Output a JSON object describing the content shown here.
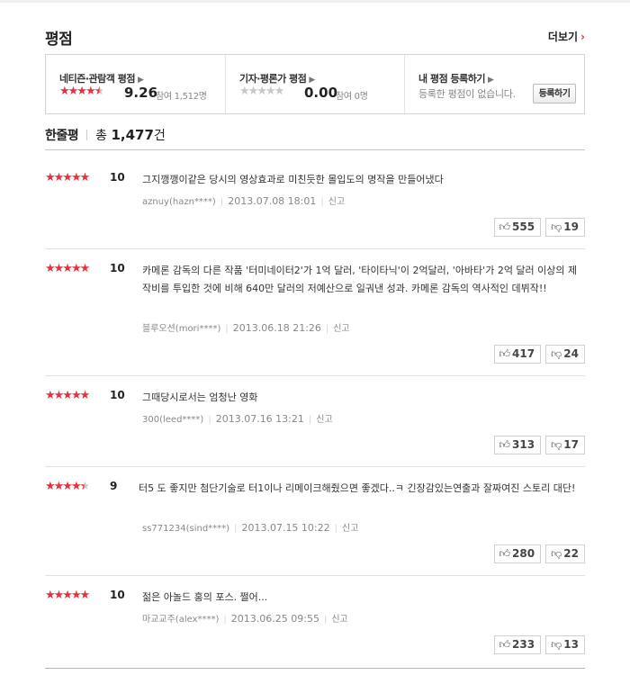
{
  "section": {
    "title": "평점",
    "more_label": "더보기",
    "more_chevron": "›"
  },
  "summary": {
    "netizen": {
      "label": "네티즌·관람객 평점",
      "stars": "★★★★★",
      "score": "9.26",
      "count": "참여 1,512명",
      "rating_fraction": 0.926
    },
    "critic": {
      "label": "기자·평론가 평점",
      "stars": "★★★★★",
      "score": "0.00",
      "count": "참여 0명",
      "rating_fraction": 0.0
    },
    "mine": {
      "label": "내 평점 등록하기",
      "empty": "등록한 평점이 없습니다.",
      "button": "등록하기"
    }
  },
  "oneline": {
    "title": "한줄평",
    "total_prefix": "총",
    "total": "1,477",
    "total_suffix": "건"
  },
  "reviews": [
    {
      "stars": "★★★★★",
      "score": "10",
      "text": "그지깽깽이같은 당시의 영상효과로 미친듯한 몰입도의 명작을 만들어냈다",
      "user": "aznuy(hazn****)",
      "date": "2013.07.08 18:01",
      "report": "신고",
      "up": "555",
      "down": "19"
    },
    {
      "stars": "★★★★★",
      "score": "10",
      "text": "카메론 감독의 다른 작품 '터미네이터2'가 1억 달러, '타이타닉'이 2억달러, '아바타'가 2억 달러 이상의 제작비를 투입한 것에 비해 640만 달러의 저예산으로 일궈낸 성과. 카메론 감독의 역사적인 데뷔작!!",
      "user": "블루오션(mori****)",
      "date": "2013.06.18 21:26",
      "report": "신고",
      "up": "417",
      "down": "24"
    },
    {
      "stars": "★★★★★",
      "score": "10",
      "text": "그때당시로서는 엄청난 영화",
      "user": "300(leed****)",
      "date": "2013.07.16 13:21",
      "report": "신고",
      "up": "313",
      "down": "17"
    },
    {
      "stars": "★★★★★",
      "score": "9",
      "text": "터5 도 좋지만 첨단기술로 터1이나 리메이크해줬으면 좋겠다..ㅋ 긴장감있는연출과 잘짜여진 스토리 대단!",
      "user": "ss771234(sind****)",
      "date": "2013.07.15 10:22",
      "report": "신고",
      "up": "280",
      "down": "22"
    },
    {
      "stars": "★★★★★",
      "score": "10",
      "text": "젊은 아놀드 홍의 포스. 쩔어...",
      "user": "마교교주(alex****)",
      "date": "2013.06.25 09:55",
      "report": "신고",
      "up": "233",
      "down": "13"
    }
  ],
  "icons": {
    "thumbs_up": "thumbs-up-icon",
    "thumbs_down": "thumbs-down-icon",
    "star": "star-icon",
    "chevron": "chevron-right-icon"
  },
  "colors": {
    "accent_red": "#e8313e",
    "star_empty": "#c8c8c8",
    "text": "#333333",
    "muted": "#888888"
  }
}
